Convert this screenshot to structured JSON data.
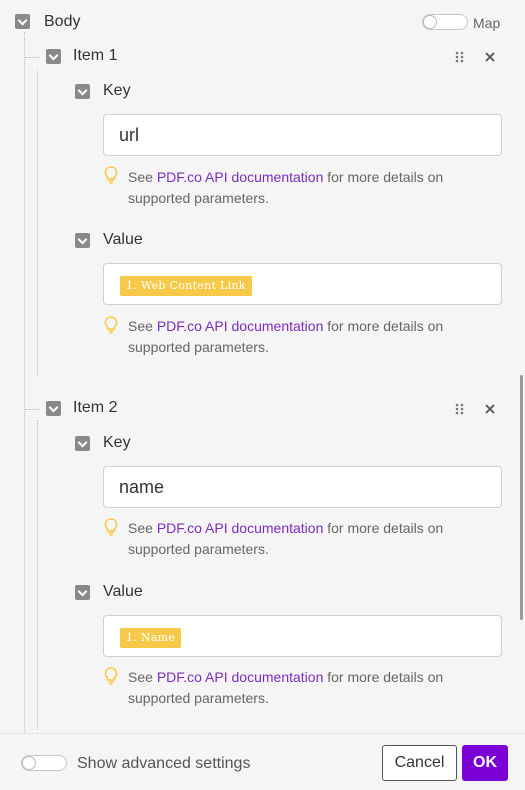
{
  "body": {
    "label": "Body",
    "map_label": "Map"
  },
  "items": [
    {
      "title": "Item 1",
      "key": {
        "label": "Key",
        "value": "url"
      },
      "value": {
        "label": "Value",
        "pill": "1. Web Content Link"
      }
    },
    {
      "title": "Item 2",
      "key": {
        "label": "Key",
        "value": "name"
      },
      "value": {
        "label": "Value",
        "pill": "1. Name"
      }
    }
  ],
  "hint": {
    "prefix": "See ",
    "link": "PDF.co API documentation",
    "suffix": " for more details on supported parameters."
  },
  "footer": {
    "advanced_label": "Show advanced settings",
    "cancel": "Cancel",
    "ok": "OK"
  },
  "colors": {
    "accent": "#7b00d6",
    "pill": "#f7c948",
    "link": "#7b2cbf"
  }
}
